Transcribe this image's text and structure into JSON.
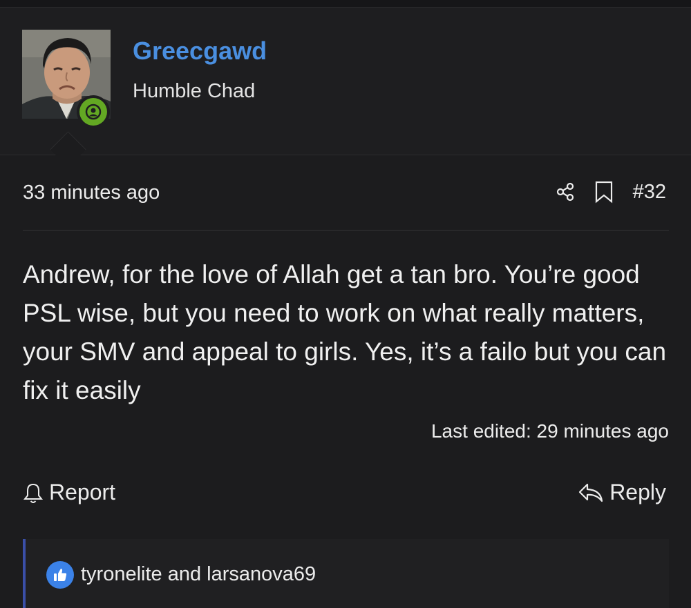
{
  "user": {
    "name": "Greecgawd",
    "title": "Humble Chad"
  },
  "post": {
    "date": "33 minutes ago",
    "number": "#32",
    "body": "Andrew, for the love of Allah get a tan bro. You’re good PSL wise, but you need to work on what really matters, your SMV and appeal to girls. Yes, it’s a failo but you can fix it easily",
    "last_edited": "Last edited: 29 minutes ago"
  },
  "actions": {
    "report_label": "Report",
    "reply_label": "Reply"
  },
  "reactions": {
    "text": "tyronelite and larsanova69"
  },
  "icons": {
    "share": "share-icon",
    "bookmark": "bookmark-icon",
    "report": "bell-icon",
    "reply": "reply-arrow-icon",
    "online": "online-user-icon",
    "like": "thumbs-up-icon"
  },
  "colors": {
    "background": "#1c1c1e",
    "username": "#4a8fe0",
    "online": "#63a823",
    "like": "#3b82e8",
    "reaction_border": "#3a4fa8"
  }
}
